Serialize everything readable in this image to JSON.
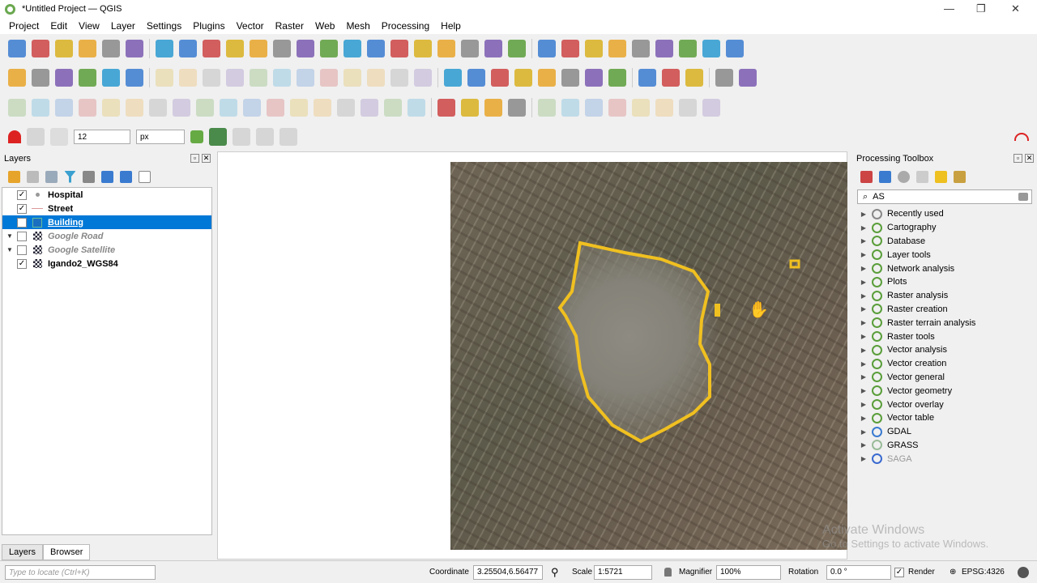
{
  "window": {
    "title": "*Untitled Project — QGIS",
    "controls": [
      "—",
      "❐",
      "✕"
    ]
  },
  "menu": [
    "Project",
    "Edit",
    "View",
    "Layer",
    "Settings",
    "Plugins",
    "Vector",
    "Raster",
    "Web",
    "Mesh",
    "Processing",
    "Help"
  ],
  "toolbars": {
    "row1": [
      "new-project",
      "open-project",
      "save-project",
      "save-as",
      "print-layout",
      "style-manager",
      "|",
      "pan",
      "pan-to-selection",
      "zoom-in",
      "zoom-out",
      "zoom-full",
      "zoom-selection",
      "zoom-layer",
      "zoom-native",
      "zoom-last",
      "zoom-next",
      "new-map-view",
      "new-3d-view",
      "new-bookmark",
      "show-bookmarks",
      "temporal",
      "refresh",
      "|",
      "identify",
      "attribute-table",
      "field-calculator",
      "select-features",
      "statistics",
      "measure",
      "annotation",
      "map-tips",
      "text-annotation"
    ],
    "row2": [
      "add-vector-layer",
      "add-raster-layer",
      "add-delimited-text",
      "add-spatialite",
      "add-virtual",
      "new-geopackage",
      "|",
      "current-edits",
      "toggle-editing",
      "save-edits",
      "add-feature",
      "move-feature",
      "vertex-tool",
      "delete",
      "cut",
      "copy",
      "paste",
      "undo",
      "redo",
      "|",
      "label-tool",
      "diagram",
      "pin-labels",
      "show-hide-labels",
      "move-label",
      "rotate-label",
      "change-label",
      "label-props",
      "|",
      "metasearch",
      "wms",
      "wfs",
      "|",
      "python-console",
      "help"
    ],
    "row3": [
      "digitize-1",
      "digitize-2",
      "digitize-3",
      "digitize-4",
      "digitize-5",
      "digitize-6",
      "digitize-7",
      "digitize-8",
      "digitize-9",
      "digitize-10",
      "digitize-11",
      "digitize-12",
      "digitize-13",
      "digitize-14",
      "digitize-15",
      "digitize-16",
      "digitize-17",
      "digitize-18",
      "|",
      "select-by-area",
      "select-by-value",
      "deselect",
      "select-all",
      "|",
      "adv-1",
      "adv-2",
      "adv-3",
      "adv-4",
      "adv-5",
      "adv-6",
      "adv-7",
      "adv-8"
    ]
  },
  "snapping": {
    "tolerance": "12",
    "unit": "px"
  },
  "layers_panel": {
    "title": "Layers",
    "items": [
      {
        "name": "Hospital",
        "checked": true,
        "style": "bold"
      },
      {
        "name": "Street",
        "checked": true,
        "style": "bold"
      },
      {
        "name": "Building",
        "checked": true,
        "style": "selected"
      },
      {
        "name": "Google Road",
        "checked": false,
        "style": "italic"
      },
      {
        "name": "Google Satellite",
        "checked": false,
        "style": "italic"
      },
      {
        "name": "Igando2_WGS84",
        "checked": true,
        "style": "bold"
      }
    ],
    "tabs": [
      "Layers",
      "Browser"
    ],
    "locator_placeholder": "Type to locate (Ctrl+K)"
  },
  "processing": {
    "title": "Processing Toolbox",
    "search": "AS",
    "items": [
      "Recently used",
      "Cartography",
      "Database",
      "Layer tools",
      "Network analysis",
      "Plots",
      "Raster analysis",
      "Raster creation",
      "Raster terrain analysis",
      "Raster tools",
      "Vector analysis",
      "Vector creation",
      "Vector general",
      "Vector geometry",
      "Vector overlay",
      "Vector table",
      "GDAL",
      "GRASS",
      "SAGA"
    ]
  },
  "status": {
    "coordinate_label": "Coordinate",
    "coordinate": "3.25504,6.56477",
    "scale_label": "Scale",
    "scale": "1:5721",
    "magnifier_label": "Magnifier",
    "magnifier": "100%",
    "rotation_label": "Rotation",
    "rotation": "0.0 °",
    "render_label": "Render",
    "crs": "EPSG:4326"
  },
  "watermark": {
    "line1": "Activate Windows",
    "line2": "Go to Settings to activate Windows."
  }
}
